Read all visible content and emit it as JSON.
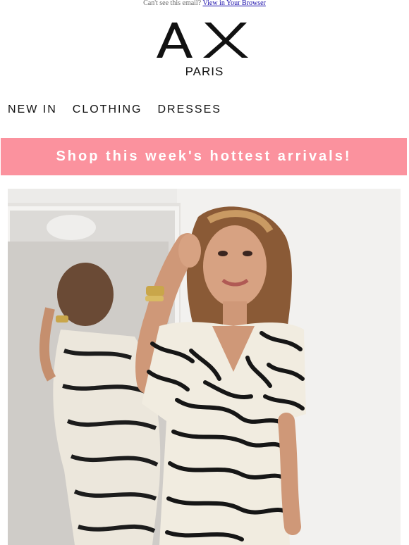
{
  "preheader": {
    "text": "Can't see this email?",
    "link_label": "View in Your Browser"
  },
  "brand": {
    "logo_mark": "AX",
    "logo_sub": "PARIS"
  },
  "nav": {
    "items": [
      {
        "label": "NEW IN"
      },
      {
        "label": "CLOTHING"
      },
      {
        "label": "DRESSES"
      }
    ]
  },
  "banner": {
    "text": "Shop this week's hottest arrivals!",
    "color": "#fb929e"
  },
  "hero": {
    "image": "model-in-zebra-print-dress-photo"
  }
}
